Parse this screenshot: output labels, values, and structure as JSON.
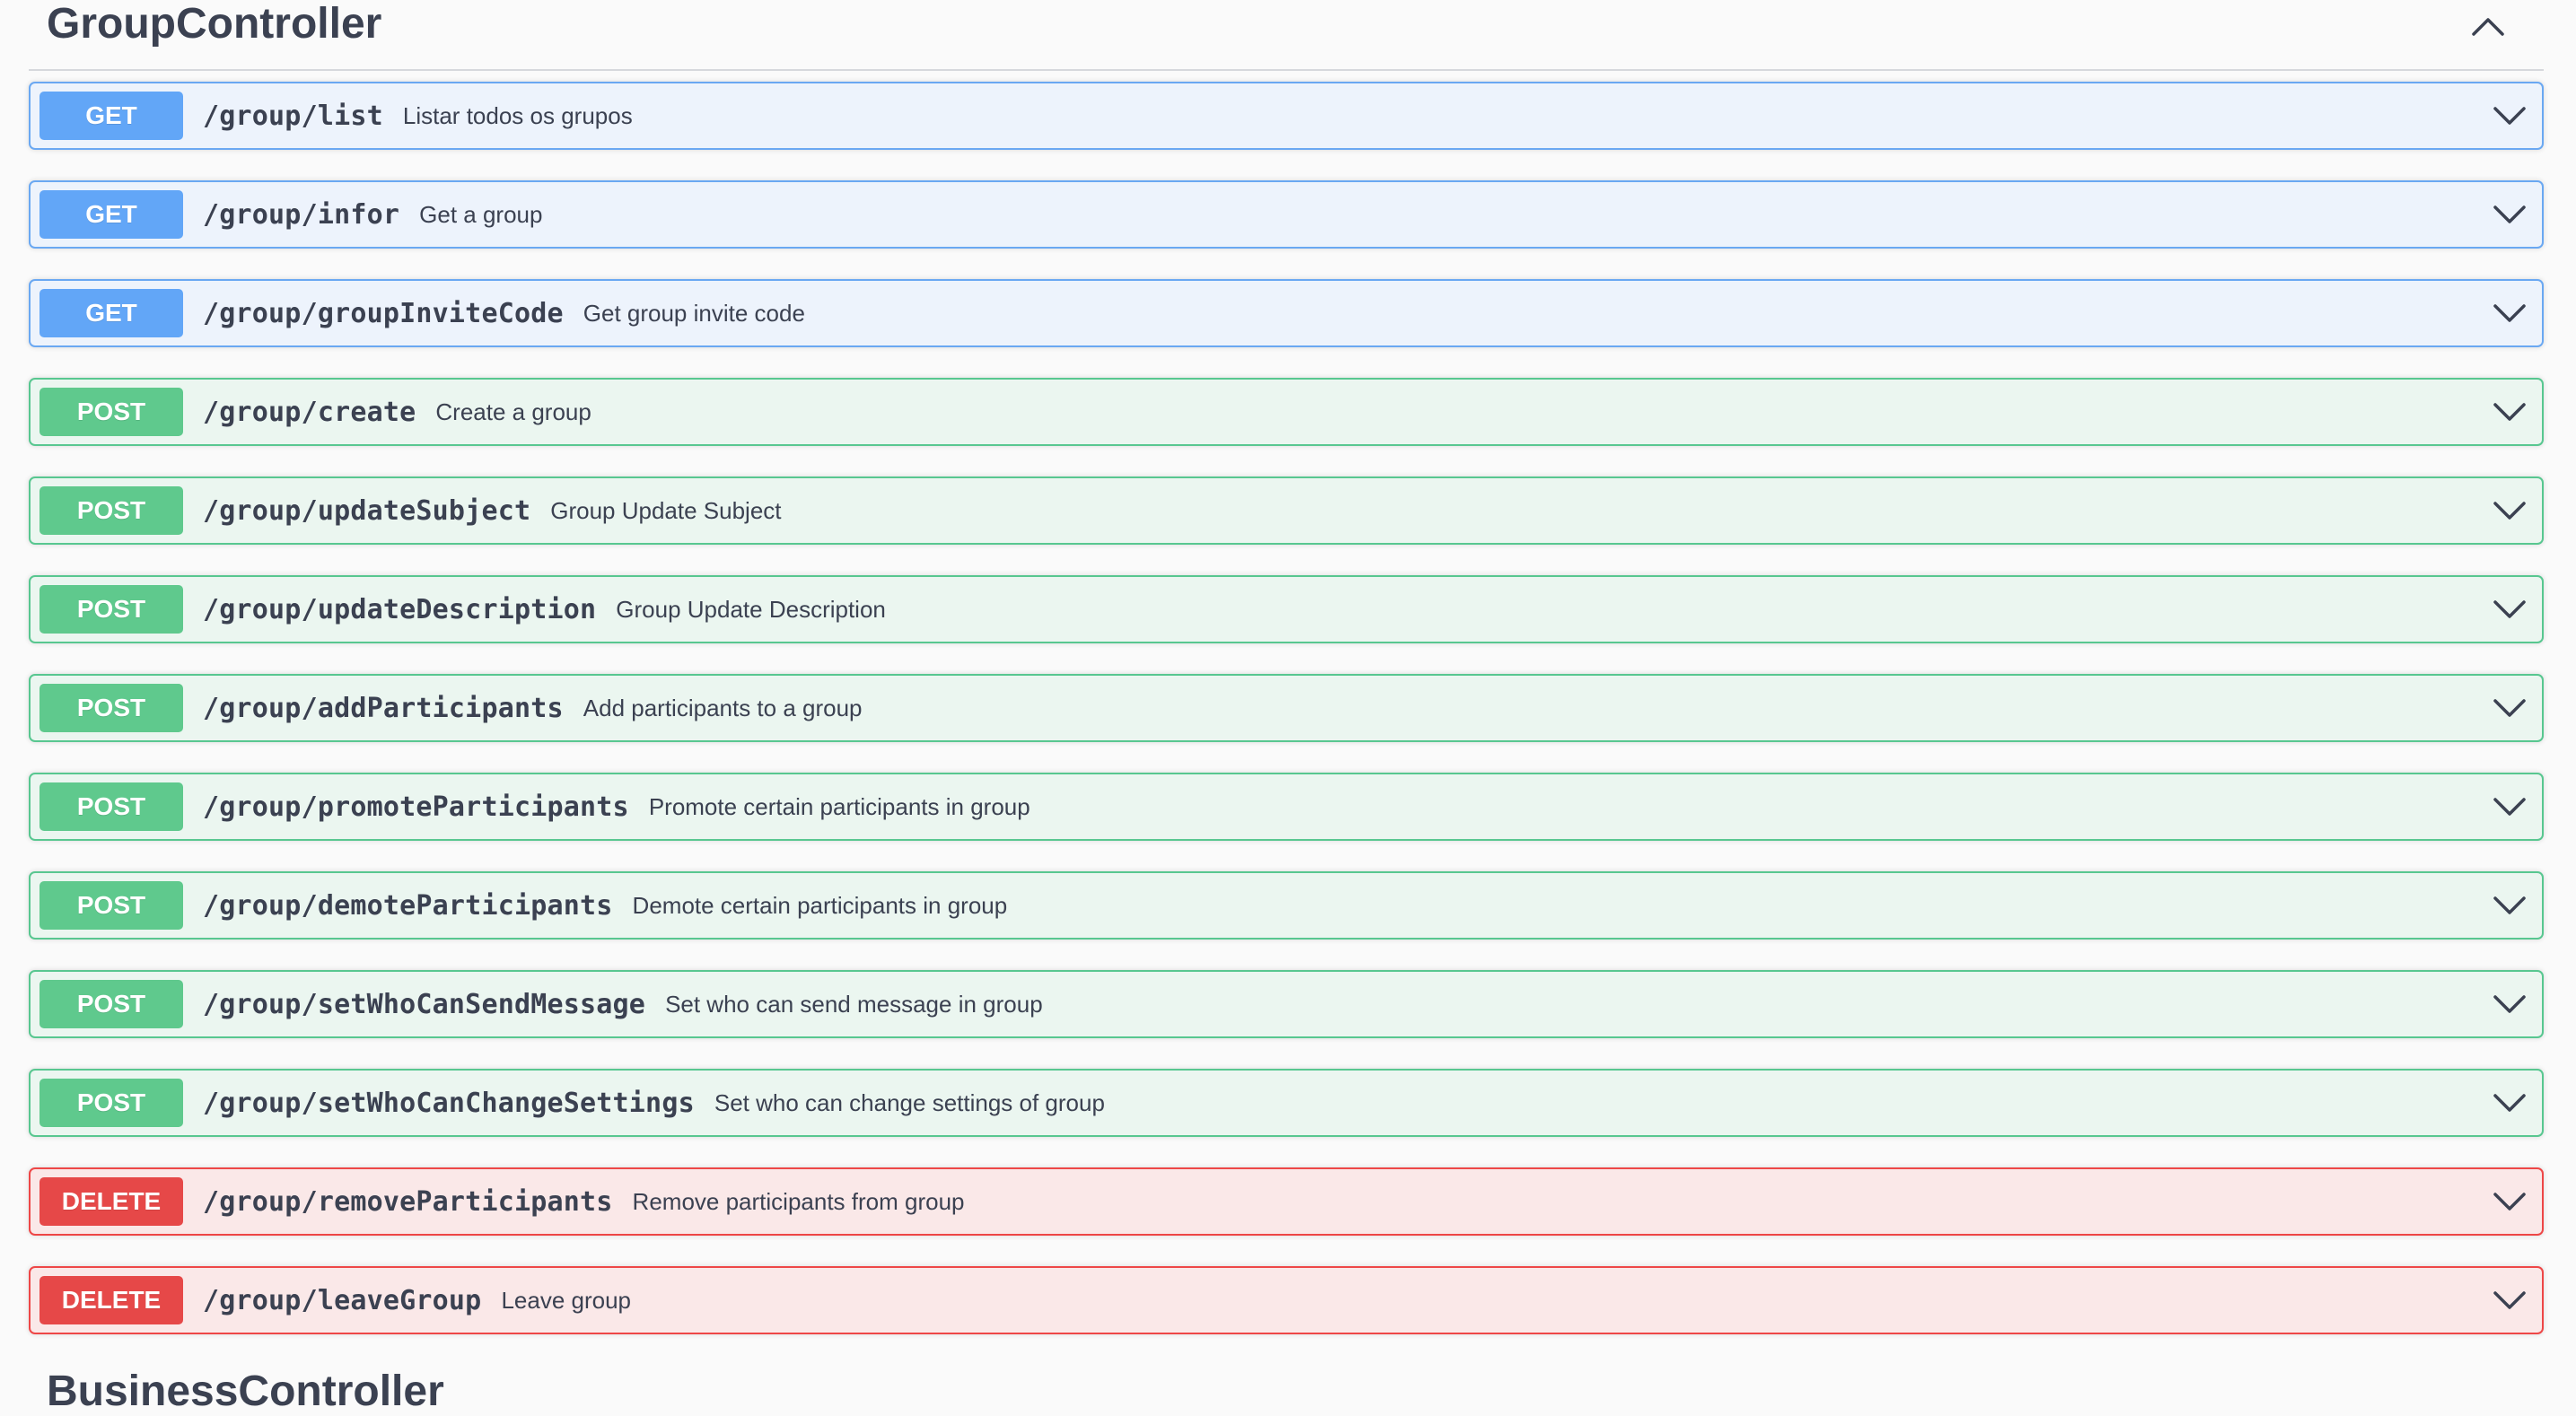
{
  "section": {
    "title": "GroupController",
    "toggle_icon": "chevron-up-icon"
  },
  "operations": [
    {
      "method": "GET",
      "path": "/group/list",
      "summary": "Listar todos os grupos"
    },
    {
      "method": "GET",
      "path": "/group/infor",
      "summary": "Get a group"
    },
    {
      "method": "GET",
      "path": "/group/groupInviteCode",
      "summary": "Get group invite code"
    },
    {
      "method": "POST",
      "path": "/group/create",
      "summary": "Create a group"
    },
    {
      "method": "POST",
      "path": "/group/updateSubject",
      "summary": "Group Update Subject"
    },
    {
      "method": "POST",
      "path": "/group/updateDescription",
      "summary": "Group Update Description"
    },
    {
      "method": "POST",
      "path": "/group/addParticipants",
      "summary": "Add participants to a group"
    },
    {
      "method": "POST",
      "path": "/group/promoteParticipants",
      "summary": "Promote certain participants in group"
    },
    {
      "method": "POST",
      "path": "/group/demoteParticipants",
      "summary": "Demote certain participants in group"
    },
    {
      "method": "POST",
      "path": "/group/setWhoCanSendMessage",
      "summary": "Set who can send message in group"
    },
    {
      "method": "POST",
      "path": "/group/setWhoCanChangeSettings",
      "summary": "Set who can change settings of group"
    },
    {
      "method": "DELETE",
      "path": "/group/removeParticipants",
      "summary": "Remove participants from group"
    },
    {
      "method": "DELETE",
      "path": "/group/leaveGroup",
      "summary": "Leave group"
    }
  ],
  "next_section": {
    "title": "BusinessController"
  },
  "colors": {
    "get": "#62a6f7",
    "post": "#5fc98d",
    "delete": "#e64848",
    "text": "#3b4151"
  }
}
